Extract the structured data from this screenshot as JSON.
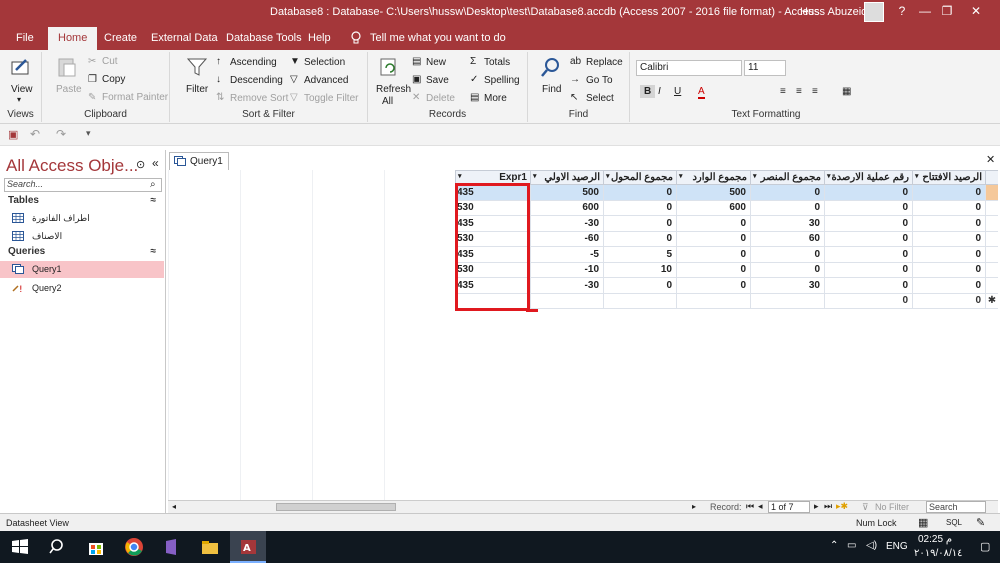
{
  "window": {
    "title": "Database8 : Database- C:\\Users\\hussw\\Desktop\\test\\Database8.accdb (Access 2007 - 2016 file format) - Access",
    "user": "Huss Abuzeid",
    "help_glyph": "?",
    "minimize_glyph": "—",
    "restore_glyph": "❐",
    "close_glyph": "✕"
  },
  "tabs": [
    "File",
    "Home",
    "Create",
    "External Data",
    "Database Tools",
    "Help"
  ],
  "tell_me": "Tell me what you want to do",
  "ribbon": {
    "views": {
      "view_label": "View",
      "group": "Views"
    },
    "clipboard": {
      "paste": "Paste",
      "cut": "Cut",
      "copy": "Copy",
      "format_painter": "Format Painter",
      "group": "Clipboard"
    },
    "sort_filter": {
      "filter": "Filter",
      "ascending": "Ascending",
      "descending": "Descending",
      "remove_sort": "Remove Sort",
      "selection": "Selection",
      "advanced": "Advanced",
      "toggle_filter": "Toggle Filter",
      "group": "Sort & Filter"
    },
    "records": {
      "refresh": "Refresh",
      "refresh_all": "All",
      "new": "New",
      "save": "Save",
      "delete": "Delete",
      "totals": "Totals",
      "spelling": "Spelling",
      "more": "More",
      "group": "Records"
    },
    "find": {
      "find": "Find",
      "replace": "Replace",
      "goto": "Go To",
      "select": "Select",
      "group": "Find"
    },
    "text_formatting": {
      "font": "Calibri",
      "size": "11",
      "bold": "B",
      "italic": "I",
      "underline": "U",
      "font_color_glyph": "A",
      "group": "Text Formatting"
    }
  },
  "nav": {
    "title": "All Access Obje...",
    "search_placeholder": "Search...",
    "sections": [
      {
        "label": "Tables",
        "items": [
          "اطراف الفاتورة",
          "الاصناف"
        ]
      },
      {
        "label": "Queries",
        "items": [
          "Query1",
          "Query2"
        ]
      }
    ]
  },
  "document": {
    "tab_label": "Query1",
    "columns": [
      "Expr1",
      "الرصيد الاولي",
      "مجموع المحول",
      "مجموع الوارد",
      "مجموع المنصر",
      "رقم عملية الارصدة",
      "الرصيد الافتتاح"
    ],
    "rows": [
      [
        "435",
        "500",
        "0",
        "500",
        "0",
        "0",
        "0"
      ],
      [
        "530",
        "600",
        "0",
        "600",
        "0",
        "0",
        "0"
      ],
      [
        "435",
        "-30",
        "0",
        "0",
        "30",
        "0",
        "0"
      ],
      [
        "530",
        "-60",
        "0",
        "0",
        "60",
        "0",
        "0"
      ],
      [
        "435",
        "-5",
        "5",
        "0",
        "0",
        "0",
        "0"
      ],
      [
        "530",
        "-10",
        "10",
        "0",
        "0",
        "0",
        "0"
      ],
      [
        "435",
        "-30",
        "0",
        "0",
        "30",
        "0",
        "0"
      ]
    ],
    "new_row": [
      "",
      "",
      "",
      "",
      "",
      "0",
      "0"
    ],
    "new_row_marker": "✱",
    "record_nav": {
      "label": "Record:",
      "current": "1 of 7",
      "filter": "No Filter",
      "search_placeholder": "Search"
    }
  },
  "status": {
    "left": "Datasheet View",
    "num_lock": "Num Lock",
    "sql": "SQL"
  },
  "taskbar": {
    "lang": "ENG",
    "time": "02:25 م",
    "date": "٢٠١٩/٠٨/١٤"
  },
  "colors": {
    "accent": "#a4373a",
    "selected_row": "#cfe3f7",
    "highlight_box": "#e0191f"
  }
}
